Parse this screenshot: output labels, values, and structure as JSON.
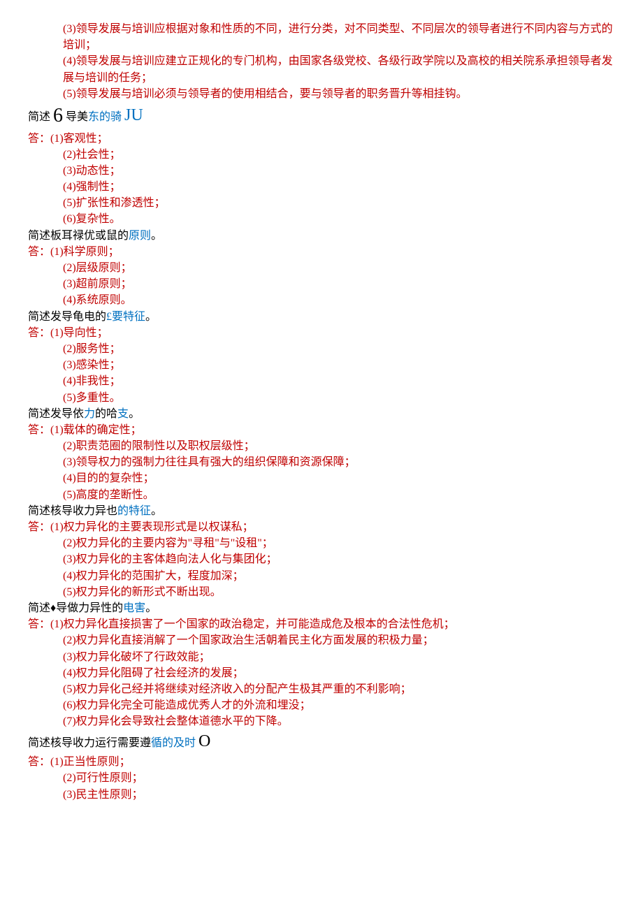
{
  "intro": {
    "p3": "(3)领导发展与培训应根据对象和性质的不同，进行分类，对不同类型、不同层次的领导者进行不同内容与方式的培训；",
    "p4": "(4)领导发展与培训应建立正规化的专门机构，由国家各级党校、各级行政学院以及高校的相关院系承担领导者发展与培训的任务；",
    "p5": "(5)领导发展与培训必须与领导者的使用相结合，要与领导者的职务晋升等相挂钩。"
  },
  "q1": {
    "title_pre": "简述 ",
    "title_big": "6",
    "title_mid": " 导美",
    "title_blue": "东的骑 ",
    "title_ju": "JU",
    "a_label": "答：",
    "items": [
      "(1)客观性；",
      "(2)社会性；",
      "(3)动态性；",
      "(4)强制性；",
      "(5)扩张性和渗透性；",
      "(6)复杂性。"
    ]
  },
  "q2": {
    "title_black": "简述板耳禄优或鼠的",
    "title_blue": "原则",
    "title_end": "。",
    "a_label": "答：",
    "items": [
      "(1)科学原则；",
      "(2)层级原则；",
      "(3)超前原则；",
      "(4)系统原则。"
    ]
  },
  "q3": {
    "title_black": "简述发导龟电的",
    "title_blue": "£要特征",
    "title_end": "。",
    "a_label": "答：",
    "items": [
      "(1)导向性；",
      "(2)服务性；",
      "(3)感染性；",
      "(4)非我性；",
      "(5)多重性。"
    ]
  },
  "q4": {
    "title_black1": "简述发导依",
    "title_blue1": "力",
    "title_black2": "的哈",
    "title_blue2": "支",
    "title_end": "。",
    "a_label": "答：",
    "items": [
      "(1)载体的确定性；",
      "(2)职责范圈的限制性以及职权层级性；",
      "(3)领导权力的强制力往往具有强大的组织保障和资源保障；",
      "(4)目的的复杂性；",
      "(5)高度的垄断性。"
    ]
  },
  "q5": {
    "title_black": "简述核导收力异也",
    "title_blue": "的特征",
    "title_end": "。",
    "a_label": "答：",
    "items": [
      "(1)权力异化的主要表现形式是以权谋私；",
      "(2)权力异化的主要内容为\"寻租\"与\"设租\"；",
      "(3)权力异化的主客体趋向法人化与集团化；",
      "(4)权力异化的范围扩大，程度加深；",
      "(5)权力异化的新形式不断出现。"
    ]
  },
  "q6": {
    "title_black": "简述♦导做力异性的",
    "title_blue": "电害",
    "title_end": "。",
    "a_label": "答：",
    "items": [
      "(1)权力异化直接损害了一个国家的政治稳定，并可能造成危及根本的合法性危机；",
      "(2)权力异化直接消解了一个国家政治生活朝着民主化方面发展的积极力量；",
      "(3)权力异化破坏了行政效能；",
      "(4)权力异化阻碍了社会经济的发展；",
      "(5)权力异化己经并将继续对经济收入的分配产生极其严重的不利影响；",
      "(6)权力异化完全可能造成优秀人才的外流和埋没；",
      "(7)权力异化会导致社会整体道德水平的下降。"
    ]
  },
  "q7": {
    "title_black": "简述核导收力运行需要遵",
    "title_blue": "循的及时 ",
    "title_big": "O",
    "a_label": "答：",
    "items": [
      "(1)正当性原则；",
      "(2)可行性原则；",
      "(3)民主性原则；"
    ]
  }
}
